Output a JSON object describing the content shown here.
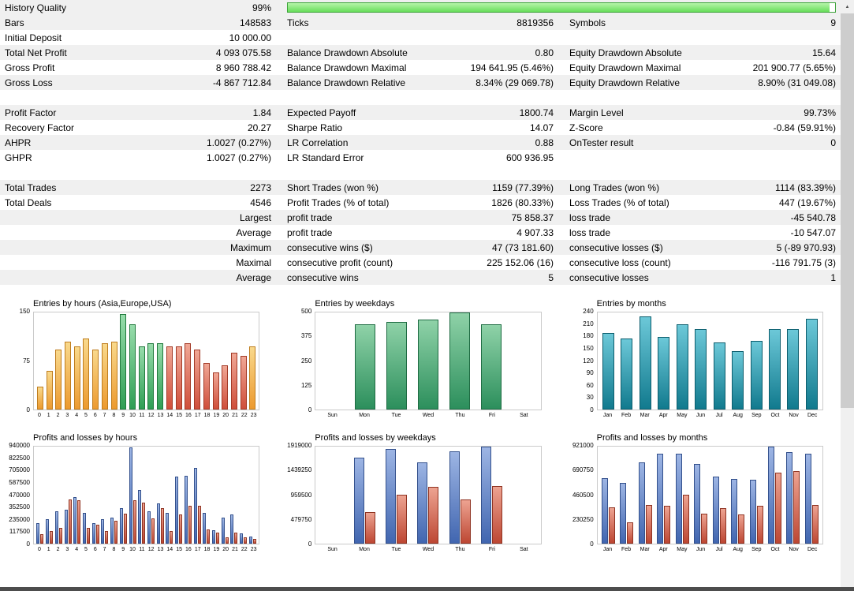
{
  "stats": {
    "history_quality": {
      "label": "History Quality",
      "value": "99%",
      "percent": 99,
      "bar_color": "#68de5b"
    },
    "rows": [
      {
        "l1": "Bars",
        "v1": "148583",
        "l2": "Ticks",
        "v2": "8819356",
        "l3": "Symbols",
        "v3": "9"
      },
      {
        "l1": "Initial Deposit",
        "v1": "10 000.00",
        "l2": "",
        "v2": "",
        "l3": "",
        "v3": ""
      },
      {
        "l1": "Total Net Profit",
        "v1": "4 093 075.58",
        "l2": "Balance Drawdown Absolute",
        "v2": "0.80",
        "l3": "Equity Drawdown Absolute",
        "v3": "15.64"
      },
      {
        "l1": "Gross Profit",
        "v1": "8 960 788.42",
        "l2": "Balance Drawdown Maximal",
        "v2": "194 641.95 (5.46%)",
        "l3": "Equity Drawdown Maximal",
        "v3": "201 900.77 (5.65%)"
      },
      {
        "l1": "Gross Loss",
        "v1": "-4 867 712.84",
        "l2": "Balance Drawdown Relative",
        "v2": "8.34% (29 069.78)",
        "l3": "Equity Drawdown Relative",
        "v3": "8.90% (31 049.08)"
      },
      {
        "l1": "",
        "v1": "",
        "l2": "",
        "v2": "",
        "l3": "",
        "v3": ""
      },
      {
        "l1": "Profit Factor",
        "v1": "1.84",
        "l2": "Expected Payoff",
        "v2": "1800.74",
        "l3": "Margin Level",
        "v3": "99.73%"
      },
      {
        "l1": "Recovery Factor",
        "v1": "20.27",
        "l2": "Sharpe Ratio",
        "v2": "14.07",
        "l3": "Z-Score",
        "v3": "-0.84 (59.91%)"
      },
      {
        "l1": "AHPR",
        "v1": "1.0027 (0.27%)",
        "l2": "LR Correlation",
        "v2": "0.88",
        "l3": "OnTester result",
        "v3": "0"
      },
      {
        "l1": "GHPR",
        "v1": "1.0027 (0.27%)",
        "l2": "LR Standard Error",
        "v2": "600 936.95",
        "l3": "",
        "v3": ""
      },
      {
        "l1": "",
        "v1": "",
        "l2": "",
        "v2": "",
        "l3": "",
        "v3": ""
      },
      {
        "l1": "Total Trades",
        "v1": "2273",
        "l2": "Short Trades (won %)",
        "v2": "1159 (77.39%)",
        "l3": "Long Trades (won %)",
        "v3": "1114 (83.39%)"
      },
      {
        "l1": "Total Deals",
        "v1": "4546",
        "l2": "Profit Trades (% of total)",
        "v2": "1826 (80.33%)",
        "l3": "Loss Trades (% of total)",
        "v3": "447 (19.67%)"
      },
      {
        "l1": "",
        "v1": "Largest",
        "l2": "profit trade",
        "v2": "75 858.37",
        "l3": "loss trade",
        "v3": "-45 540.78"
      },
      {
        "l1": "",
        "v1": "Average",
        "l2": "profit trade",
        "v2": "4 907.33",
        "l3": "loss trade",
        "v3": "-10 547.07"
      },
      {
        "l1": "",
        "v1": "Maximum",
        "l2": "consecutive wins ($)",
        "v2": "47 (73 181.60)",
        "l3": "consecutive losses ($)",
        "v3": "5 (-89 970.93)"
      },
      {
        "l1": "",
        "v1": "Maximal",
        "l2": "consecutive profit (count)",
        "v2": "225 152.06 (16)",
        "l3": "consecutive loss (count)",
        "v3": "-116 791.75 (3)"
      },
      {
        "l1": "",
        "v1": "Average",
        "l2": "consecutive wins",
        "v2": "5",
        "l3": "consecutive losses",
        "v3": "1"
      }
    ]
  },
  "colors": {
    "asia_session": "#f2a93b",
    "europe_session": "#3fa05f",
    "usa_session": "#d5543f",
    "weekday_entries": "#3d9a64",
    "month_entries": "#1b8fa0",
    "profit_bar": "#5b7fc7",
    "loss_bar": "#c65a45",
    "quality_bar": "#68de5b"
  },
  "scrollbar": {
    "up_icon": "▲"
  },
  "chart_data": [
    {
      "type": "bar",
      "title": "Entries by hours (Asia,Europe,USA)",
      "categories": [
        "0",
        "1",
        "2",
        "3",
        "4",
        "5",
        "6",
        "7",
        "8",
        "9",
        "10",
        "11",
        "12",
        "13",
        "14",
        "15",
        "16",
        "17",
        "18",
        "19",
        "20",
        "21",
        "22",
        "23"
      ],
      "values": [
        35,
        60,
        93,
        105,
        98,
        110,
        93,
        103,
        105,
        147,
        132,
        98,
        103,
        103,
        98,
        97,
        103,
        93,
        72,
        57,
        68,
        88,
        83,
        97
      ],
      "bar_classes": [
        "asia",
        "asia",
        "asia",
        "asia",
        "asia",
        "asia",
        "asia",
        "asia",
        "asia",
        "europe",
        "europe",
        "europe",
        "europe",
        "europe",
        "usa",
        "usa",
        "usa",
        "usa",
        "usa",
        "usa",
        "usa",
        "usa",
        "usa",
        "asia"
      ],
      "yticks": [
        0,
        75,
        150
      ],
      "ylim": [
        0,
        150
      ],
      "xlabel": "",
      "ylabel": "",
      "legend": false,
      "grid": false
    },
    {
      "type": "bar",
      "title": "Entries by weekdays",
      "categories": [
        "Sun",
        "Mon",
        "Tue",
        "Wed",
        "Thu",
        "Fri",
        "Sat"
      ],
      "values": [
        0,
        440,
        450,
        462,
        500,
        440,
        0
      ],
      "bar_class": "wday",
      "yticks": [
        0,
        125,
        250,
        375,
        500
      ],
      "ylim": [
        0,
        500
      ],
      "xlabel": "",
      "ylabel": "",
      "legend": false,
      "grid": false
    },
    {
      "type": "bar",
      "title": "Entries by months",
      "categories": [
        "Jan",
        "Feb",
        "Mar",
        "Apr",
        "May",
        "Jun",
        "Jul",
        "Aug",
        "Sep",
        "Oct",
        "Nov",
        "Dec"
      ],
      "values": [
        190,
        175,
        230,
        180,
        210,
        200,
        165,
        145,
        170,
        200,
        200,
        225
      ],
      "bar_class": "month",
      "yticks": [
        0,
        30,
        60,
        90,
        120,
        150,
        180,
        210,
        240
      ],
      "ylim": [
        0,
        240
      ],
      "xlabel": "",
      "ylabel": "",
      "legend": false,
      "grid": false
    },
    {
      "type": "bar",
      "title": "Profits and losses by hours",
      "categories": [
        "0",
        "1",
        "2",
        "3",
        "4",
        "5",
        "6",
        "7",
        "8",
        "9",
        "10",
        "11",
        "12",
        "13",
        "14",
        "15",
        "16",
        "17",
        "18",
        "19",
        "20",
        "21",
        "22",
        "23"
      ],
      "series": [
        {
          "name": "profit",
          "values": [
            195000,
            235000,
            310000,
            330000,
            450000,
            300000,
            195000,
            235000,
            250000,
            345000,
            930000,
            520000,
            310000,
            390000,
            300000,
            650000,
            655000,
            735000,
            300000,
            130000,
            250000,
            280000,
            100000,
            70000
          ]
        },
        {
          "name": "loss",
          "values": [
            95000,
            125000,
            150000,
            430000,
            420000,
            150000,
            185000,
            120000,
            225000,
            290000,
            420000,
            395000,
            245000,
            345000,
            125000,
            285000,
            365000,
            370000,
            135000,
            110000,
            65000,
            105000,
            65000,
            45000
          ]
        }
      ],
      "yticks": [
        0,
        117500,
        235000,
        352500,
        470000,
        587500,
        705000,
        822500,
        940000
      ],
      "ylim": [
        0,
        940000
      ],
      "xlabel": "",
      "ylabel": "",
      "legend": false,
      "grid": false
    },
    {
      "type": "bar",
      "title": "Profits and losses by weekdays",
      "categories": [
        "Sun",
        "Mon",
        "Tue",
        "Wed",
        "Thu",
        "Fri",
        "Sat"
      ],
      "series": [
        {
          "name": "profit",
          "values": [
            0,
            1700000,
            1880000,
            1610000,
            1830000,
            1919000,
            0
          ]
        },
        {
          "name": "loss",
          "values": [
            0,
            620000,
            970000,
            1120000,
            880000,
            1140000,
            0
          ]
        }
      ],
      "yticks": [
        0,
        479750,
        959500,
        1439250,
        1919000
      ],
      "ylim": [
        0,
        1919000
      ],
      "xlabel": "",
      "ylabel": "",
      "legend": false,
      "grid": false
    },
    {
      "type": "bar",
      "title": "Profits and losses by months",
      "categories": [
        "Jan",
        "Feb",
        "Mar",
        "Apr",
        "May",
        "Jun",
        "Jul",
        "Aug",
        "Sep",
        "Oct",
        "Nov",
        "Dec"
      ],
      "series": [
        {
          "name": "profit",
          "values": [
            620000,
            580000,
            770000,
            850000,
            855000,
            755000,
            640000,
            615000,
            610000,
            921000,
            865000,
            855000
          ]
        },
        {
          "name": "loss",
          "values": [
            345000,
            200000,
            370000,
            360000,
            465000,
            285000,
            335000,
            280000,
            360000,
            675000,
            690000,
            370000
          ]
        }
      ],
      "yticks": [
        0,
        230250,
        460500,
        690750,
        921000
      ],
      "ylim": [
        0,
        921000
      ],
      "xlabel": "",
      "ylabel": "",
      "legend": false,
      "grid": false
    }
  ]
}
